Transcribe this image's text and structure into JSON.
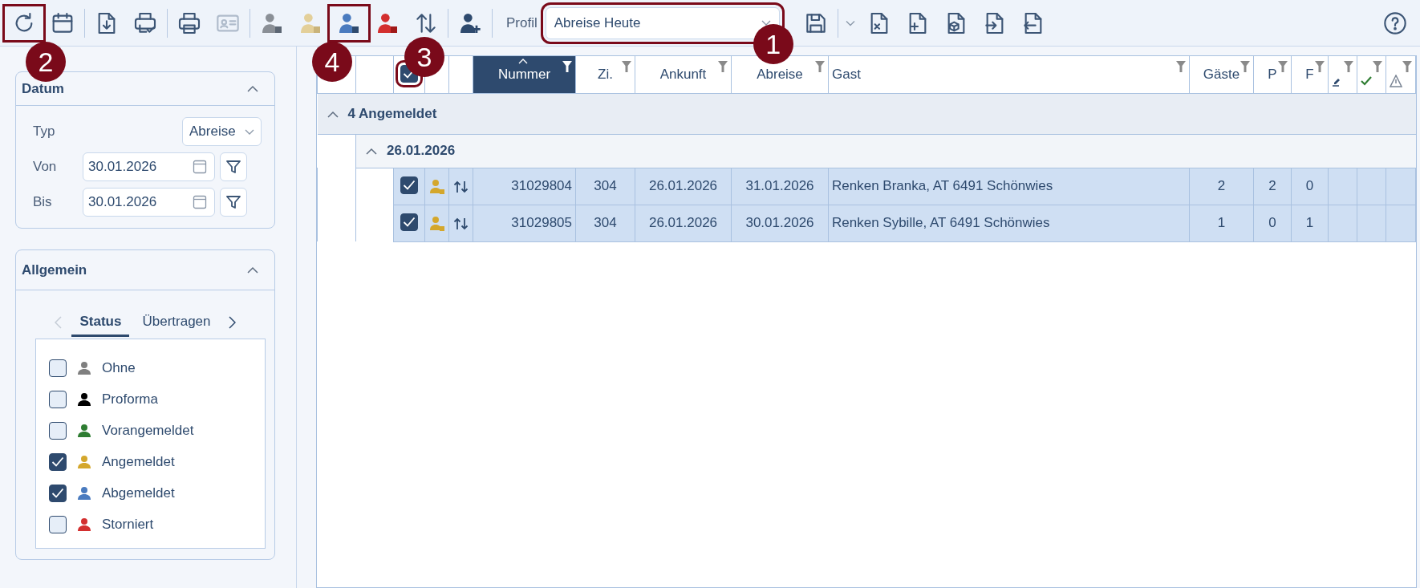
{
  "toolbar": {
    "groups": [
      {
        "buttons": [
          {
            "disabled": false
          },
          {
            "disabled": false
          }
        ]
      },
      {
        "buttons": [
          {
            "disabled": false
          },
          {
            "disabled": false
          }
        ]
      },
      {
        "buttons": [
          {
            "disabled": false
          },
          {
            "disabled": true
          }
        ]
      },
      {
        "buttons": [
          {
            "disabled": false
          },
          {
            "disabled": false
          },
          {
            "disabled": false
          },
          {
            "disabled": false
          },
          {
            "disabled": false
          }
        ]
      },
      {
        "buttons": [
          {
            "disabled": false
          }
        ]
      }
    ],
    "profile_label": "Profil",
    "profile_value": "Abreise Heute",
    "file_buttons": [
      {
        "disabled": false
      },
      {
        "disabled": false
      },
      {
        "disabled": false
      },
      {
        "disabled": false
      },
      {
        "disabled": false
      }
    ]
  },
  "sidebar": {
    "datum": {
      "title": "Datum",
      "expanded": true,
      "typ_label": "Typ",
      "typ_value": "Abreise",
      "von_label": "Von",
      "von_value": "30.01.2026",
      "bis_label": "Bis",
      "bis_value": "30.01.2026"
    },
    "allgemein": {
      "title": "Allgemein",
      "expanded": true,
      "tabs": [
        {
          "label": "Status",
          "selected": true
        },
        {
          "label": "Übertragen",
          "selected": false
        }
      ],
      "statuses": [
        {
          "label": "Ohne",
          "checked": false,
          "color": "#7f7f7f"
        },
        {
          "label": "Proforma",
          "checked": false,
          "color": "#000000"
        },
        {
          "label": "Vorangemeldet",
          "checked": false,
          "color": "#2e7d32"
        },
        {
          "label": "Angemeldet",
          "checked": true,
          "color": "#d4a72c"
        },
        {
          "label": "Abgemeldet",
          "checked": true,
          "color": "#4a7bbf"
        },
        {
          "label": "Storniert",
          "checked": false,
          "color": "#d32f2f"
        }
      ]
    }
  },
  "grid": {
    "columns": [
      {
        "kind": "blank"
      },
      {
        "kind": "blank"
      },
      {
        "kind": "checkbox",
        "checked": true
      },
      {
        "kind": "blank"
      },
      {
        "kind": "blank"
      },
      {
        "kind": "text",
        "label": "Nummer",
        "sorted": true
      },
      {
        "kind": "text",
        "label": "Zi.",
        "sorted": false
      },
      {
        "kind": "text",
        "label": "Ankunft",
        "sorted": false
      },
      {
        "kind": "text",
        "label": "Abreise",
        "sorted": false
      },
      {
        "kind": "text",
        "label": "Gast",
        "sorted": false
      },
      {
        "kind": "text",
        "label": "Gäste",
        "sorted": false
      },
      {
        "kind": "text",
        "label": "P",
        "sorted": false
      },
      {
        "kind": "text",
        "label": "F",
        "sorted": false
      },
      {
        "kind": "icon",
        "sorted": false
      },
      {
        "kind": "icon",
        "sorted": false
      },
      {
        "kind": "icon",
        "sorted": false
      }
    ],
    "groups": [
      {
        "label": "4 Angemeldet",
        "expanded": true,
        "children": [
          {
            "label": "26.01.2026",
            "expanded": true,
            "rows": [
              {
                "selected": true,
                "checked": true,
                "color": "#d4a72c",
                "number": "31029804",
                "room": "304",
                "arrival": "26.01.2026",
                "departure": "31.01.2026",
                "guest": "Renken Branka, AT 6491 Schönwies",
                "guests": "2",
                "p": "2",
                "f": "0"
              },
              {
                "selected": true,
                "checked": true,
                "color": "#d4a72c",
                "number": "31029805",
                "room": "304",
                "arrival": "26.01.2026",
                "departure": "30.01.2026",
                "guest": "Renken Sybille, AT 6491 Schönwies",
                "guests": "1",
                "p": "0",
                "f": "1"
              }
            ]
          }
        ]
      }
    ]
  },
  "annotations": [
    {
      "label": "2"
    },
    {
      "label": "4"
    },
    {
      "label": "3"
    },
    {
      "label": "1"
    }
  ]
}
